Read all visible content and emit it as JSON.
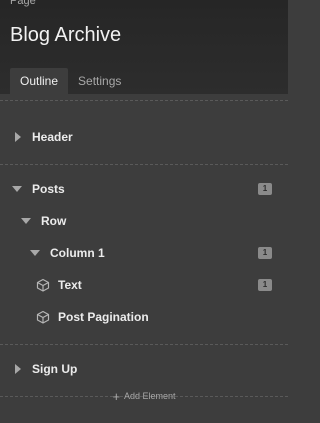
{
  "header": {
    "kicker": "Page",
    "title": "Blog Archive"
  },
  "tabs": [
    {
      "label": "Outline"
    },
    {
      "label": "Settings"
    }
  ],
  "outline": {
    "header": {
      "label": "Header"
    },
    "posts": {
      "label": "Posts",
      "count": "1"
    },
    "row": {
      "label": "Row"
    },
    "column": {
      "label": "Column 1",
      "count": "1"
    },
    "text": {
      "label": "Text",
      "count": "1"
    },
    "pagination": {
      "label": "Post Pagination"
    },
    "signup": {
      "label": "Sign Up"
    }
  },
  "add_element": {
    "label": "Add Element"
  }
}
